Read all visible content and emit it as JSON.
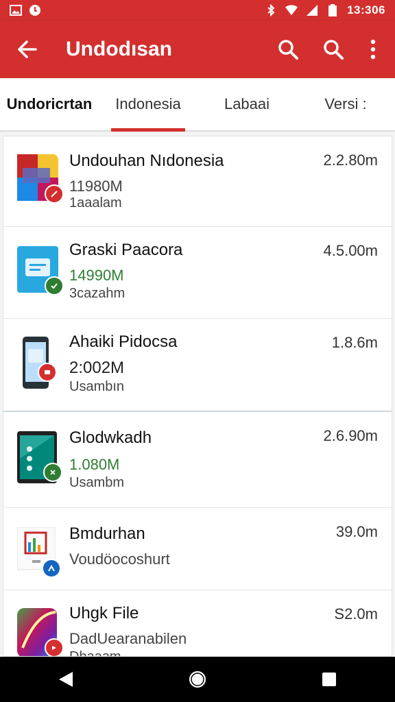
{
  "status_bar": {
    "time": "13:306",
    "left_icons": [
      "gallery-icon",
      "notification-icon"
    ],
    "right_icons": [
      "bluetooth-icon",
      "wifi-icon",
      "signal-icon",
      "battery-icon"
    ]
  },
  "toolbar": {
    "title": "Undodısan",
    "back_icon": "arrow-left-icon",
    "action_icons": [
      "search-icon",
      "search-icon",
      "more-vert-icon"
    ]
  },
  "tabs": [
    {
      "label": "Undoricrtan",
      "active": false
    },
    {
      "label": "Indonesia",
      "active": true
    },
    {
      "label": "Labaai",
      "active": false
    },
    {
      "label": "Versi :",
      "active": false
    }
  ],
  "items": [
    {
      "title": "Undouhan Nıdonesia",
      "line1": "11980M",
      "line1_color": "#444444",
      "line2": "1aaalam",
      "size": "2.2.80m",
      "badge_color": "#d32f2f",
      "icon": "flag-app-icon"
    },
    {
      "title": "Graski Paacora",
      "line1": "14990M",
      "line1_color": "#2e7d32",
      "line2": "3cazahm",
      "size": "4.5.00m",
      "badge_color": "#2e7d32",
      "icon": "chat-app-icon"
    },
    {
      "title": "Ahaiki Pidocsa",
      "line1": "2:002M",
      "line1_color": "#222222",
      "line2": "Usambın",
      "size": "1.8.6m",
      "badge_color": "#d32f2f",
      "icon": "phone-app-icon"
    },
    {
      "title": "Glodwkadh",
      "line1": "1.080M",
      "line1_color": "#2e7d32",
      "line2": "Usambm",
      "size": "2.6.90m",
      "badge_color": "#2e7d32",
      "icon": "tablet-app-icon"
    },
    {
      "title": "Bmdurhan",
      "line1": "Voudöocoshurt",
      "line1_color": "#444444",
      "line2": "",
      "size": "39.0m",
      "badge_color": "#1565c0",
      "icon": "chart-app-icon"
    },
    {
      "title": "Uhgk File",
      "line1": "DadUearanabilen",
      "line1_color": "#444444",
      "line2": "Dhaaam",
      "size": "S2.0m",
      "badge_color": "#d32f2f",
      "icon": "gradient-app-icon"
    }
  ],
  "nav_bar": [
    "back-triangle-icon",
    "home-circle-icon",
    "recents-square-icon"
  ]
}
